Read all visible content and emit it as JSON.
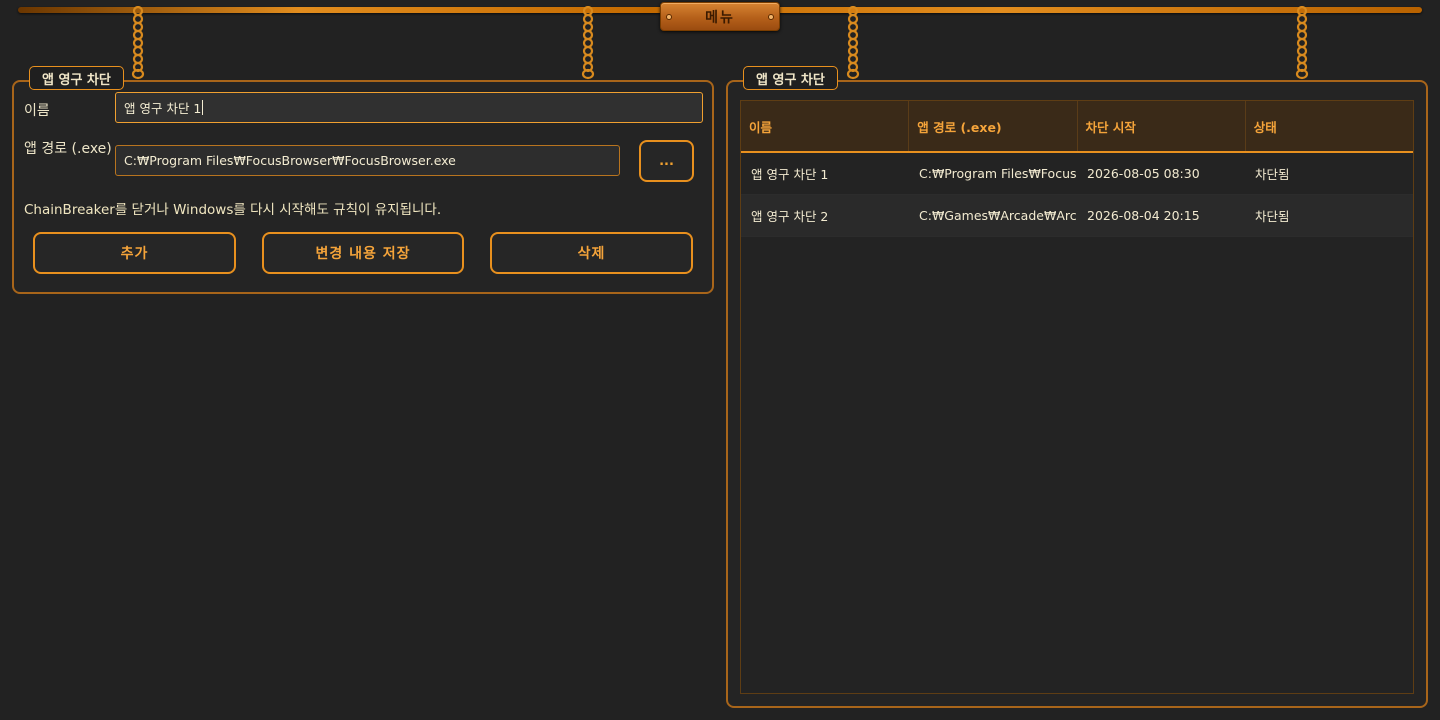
{
  "menu": {
    "label": "메뉴"
  },
  "left_panel": {
    "title": "앱 영구 차단",
    "name_label": "이름",
    "name_value": "앱 영구 차단 1",
    "path_label": "앱 경로 (.exe)",
    "path_value": "C:₩Program Files₩FocusBrowser₩FocusBrowser.exe",
    "browse_label": "...",
    "note": "ChainBreaker를 닫거나 Windows를 다시 시작해도 규칙이 유지됩니다.",
    "add_label": "추가",
    "save_label": "변경 내용 저장",
    "delete_label": "삭제"
  },
  "right_panel": {
    "title": "앱 영구 차단",
    "columns": [
      "이름",
      "앱 경로 (.exe)",
      "차단 시작",
      "상태"
    ],
    "rows": [
      [
        "앱 영구 차단 1",
        "C:₩Program Files₩Focus...",
        "2026-08-05 08:30",
        "차단됨"
      ],
      [
        "앱 영구 차단 2",
        "C:₩Games₩Arcade₩Arca...",
        "2026-08-04 20:15",
        "차단됨"
      ]
    ]
  },
  "colors": {
    "accent": "#e8901e",
    "background": "#222222",
    "text": "#ede5c8"
  }
}
